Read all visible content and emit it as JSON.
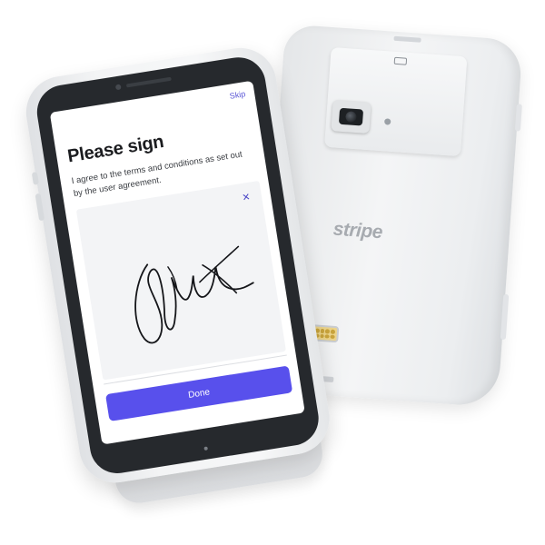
{
  "back_device": {
    "brand": "stripe"
  },
  "screen": {
    "skip_label": "Skip",
    "title": "Please sign",
    "body": "I agree to the terms and conditions as set out by the user agreement.",
    "clear_symbol": "×",
    "done_label": "Done"
  },
  "colors": {
    "accent": "#5850ec",
    "link": "#5b57d6",
    "device_shell": "#eef0f2",
    "bezel": "#26292d"
  },
  "icons": {
    "clear": "close-icon",
    "camera": "camera-icon"
  }
}
